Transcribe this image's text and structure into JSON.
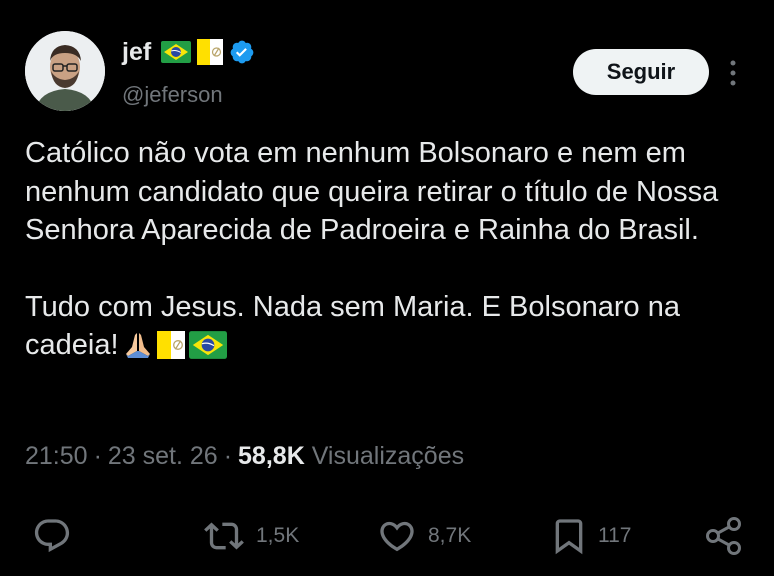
{
  "user": {
    "display_name": "jef",
    "handle": "@jeferson",
    "flags": [
      "brazil-flag",
      "vatican-flag"
    ],
    "verified": true,
    "avatar": "profile-photo"
  },
  "header": {
    "follow_label": "Seguir",
    "more_icon": "vertical-ellipsis-icon"
  },
  "tweet": {
    "paragraph_1": "Católico não vota em nenhum Bolsonaro e nem em nenhum candidato que queira retirar o título de Nossa Senhora Aparecida de Padroeira e Rainha do Brasil.",
    "paragraph_2": "Tudo com Jesus. Nada sem Maria. E Bolsonaro na cadeia!",
    "paragraph_2_emojis": [
      "praying-hands-icon",
      "vatican-flag",
      "brazil-flag"
    ]
  },
  "meta": {
    "time": "21:50",
    "separator": "·",
    "date": "23 set. 26",
    "views_count": "58,8K",
    "views_label": "Visualizações"
  },
  "actions": {
    "reply_icon": "reply-icon",
    "retweet_icon": "retweet-icon",
    "retweet_count": "1,5K",
    "like_icon": "heart-icon",
    "like_count": "8,7K",
    "bookmark_icon": "bookmark-icon",
    "bookmark_count": "117",
    "share_icon": "share-icon"
  },
  "colors": {
    "background": "#000000",
    "text_primary": "#e7e9ea",
    "text_secondary": "#71767b",
    "verified_blue": "#1d9bf0",
    "button_bg": "#eff3f4"
  }
}
